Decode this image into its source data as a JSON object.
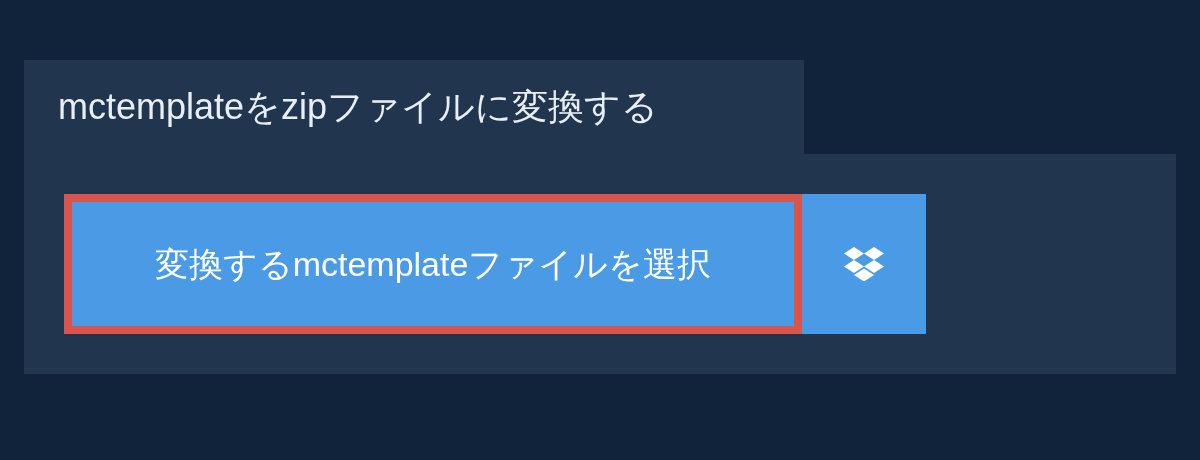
{
  "tab": {
    "title": "mctemplateをzipファイルに変換する"
  },
  "choose_button": {
    "label": "変換するmctemplateファイルを選択",
    "focused": true
  }
}
